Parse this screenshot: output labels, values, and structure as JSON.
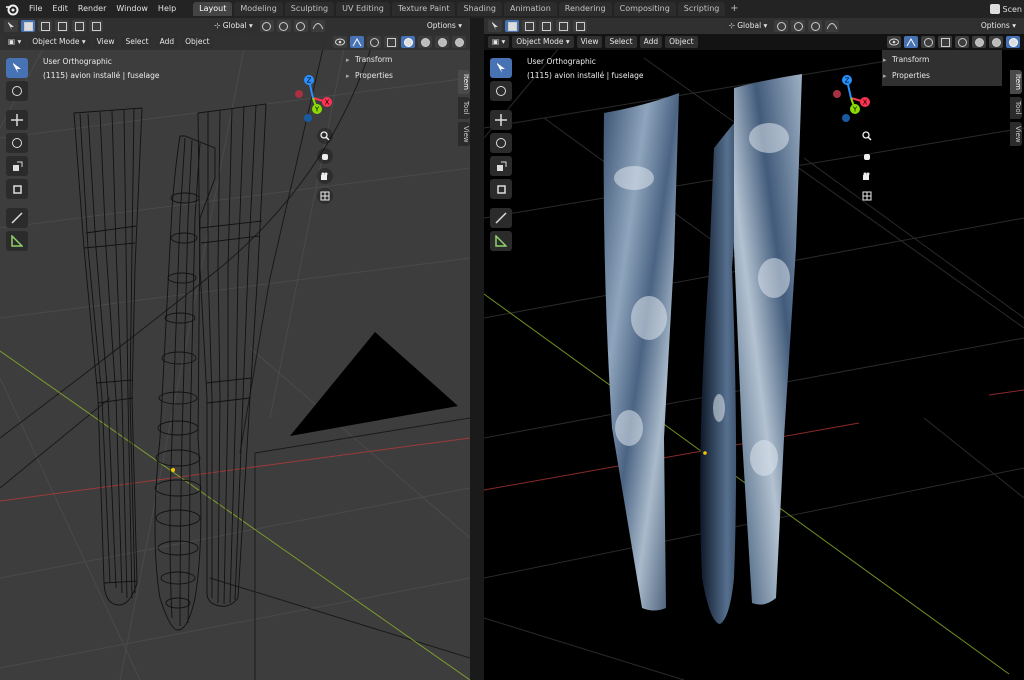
{
  "menu": [
    "File",
    "Edit",
    "Render",
    "Window",
    "Help"
  ],
  "workspaces": [
    "Layout",
    "Modeling",
    "Sculpting",
    "UV Editing",
    "Texture Paint",
    "Shading",
    "Animation",
    "Rendering",
    "Compositing",
    "Scripting"
  ],
  "active_workspace": "Layout",
  "scene_label": "Scen",
  "header": {
    "orientation": "Global",
    "options": "Options",
    "mode": "Object Mode",
    "view": "View",
    "select": "Select",
    "add": "Add",
    "object": "Object"
  },
  "viewport": {
    "view_name": "User Orthographic",
    "object_info": "(1115) avion installé | fuselage"
  },
  "npanel": {
    "transform": "Transform",
    "properties": "Properties"
  },
  "side_tabs": [
    "Item",
    "Tool",
    "View"
  ],
  "gizmo": {
    "x": "X",
    "y": "Y",
    "z": "Z"
  },
  "colors": {
    "accent": "#4772b3",
    "axis_x": "#ff3352",
    "axis_y": "#8bdc00",
    "axis_z": "#2890ff",
    "wireframe_bg": "#3d3d3d",
    "render_bg": "#000000"
  }
}
